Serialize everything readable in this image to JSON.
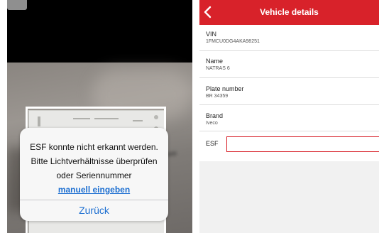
{
  "scanner": {
    "dialog": {
      "line1": "ESF konnte nicht erkannt werden.",
      "line2": "Bitte Lichtverhältnisse überprüfen",
      "line3": "oder Seriennummer",
      "manual_link": "manuell eingeben",
      "back_button": "Zurück"
    },
    "colors": {
      "link": "#1d6fd1",
      "dialog_bg": "#f7f7f7"
    }
  },
  "vehicle_details": {
    "header": {
      "title": "Vehicle details",
      "back_icon": "chevron-left-icon",
      "color": "#d8222a"
    },
    "fields": [
      {
        "label": "VIN",
        "value": "1FMCU0DG4AKA98251"
      },
      {
        "label": "Name",
        "value": "NATRAS 6"
      },
      {
        "label": "Plate number",
        "value": "BR 34359"
      },
      {
        "label": "Brand",
        "value": "Iveco"
      }
    ],
    "esf": {
      "label": "ESF",
      "value": "",
      "placeholder": ""
    }
  }
}
